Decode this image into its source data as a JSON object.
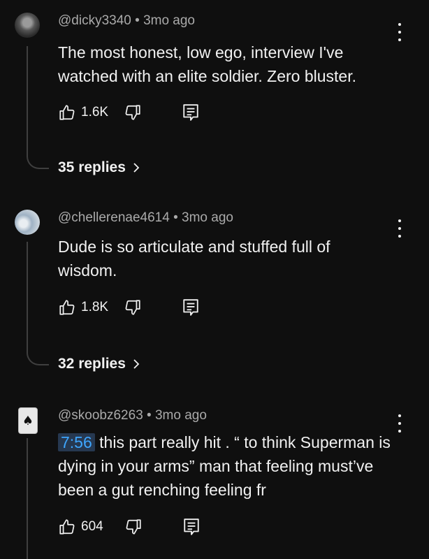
{
  "comments": [
    {
      "handle": "@dicky3340",
      "sep": "•",
      "age": "3mo ago",
      "text": "The most honest, low ego, interview I've watched with an elite soldier. Zero bluster.",
      "likes": "1.6K",
      "replies": "35 replies",
      "avatar_icon": "profile-avatar"
    },
    {
      "handle": "@chellerenae4614",
      "sep": "•",
      "age": "3mo ago",
      "text": "Dude is so articulate and stuffed full of wisdom.",
      "likes": "1.8K",
      "replies": "32 replies",
      "avatar_icon": "profile-avatar"
    },
    {
      "handle": "@skoobz6263",
      "sep": "•",
      "age": "3mo ago",
      "timestamp": "7:56",
      "text": " this part really hit . “ to think Superman is dying in your arms” man that feeling must’ve been a gut renching feeling fr",
      "likes": "604",
      "avatar_icon": "ace-of-spades-card",
      "avatar_glyph": "♠"
    }
  ],
  "colors": {
    "background": "#0f0f0f",
    "primary_text": "#f1f1f1",
    "secondary_text": "#aaaaaa",
    "timestamp_link": "#3ea6ff",
    "timestamp_bg": "#263850"
  }
}
